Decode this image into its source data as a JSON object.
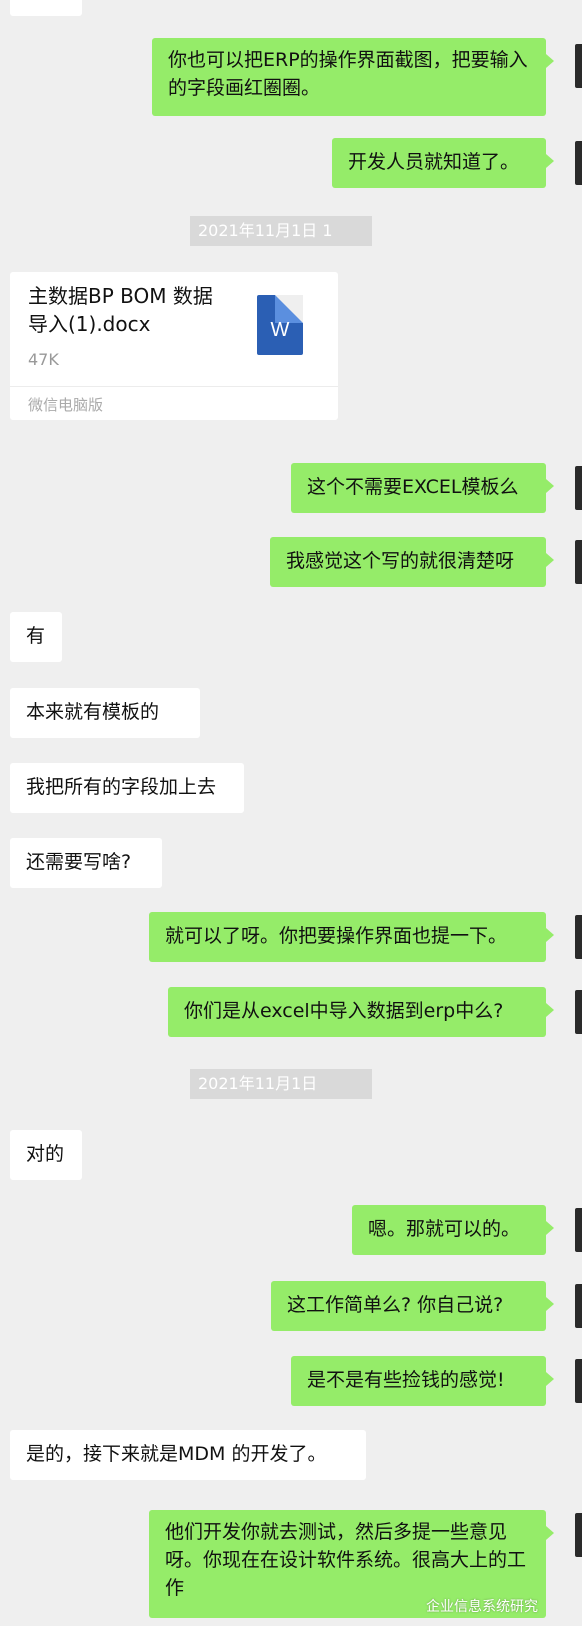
{
  "messages": [
    {
      "side": "right",
      "text": "你也可以把ERP的操作界面截图，把要输入的字段画红圈圈。"
    },
    {
      "side": "right",
      "text": "开发人员就知道了。"
    },
    {
      "side": "system",
      "text": "2021年11月1日 1"
    },
    {
      "side": "left-file",
      "file_name": "主数据BP BOM 数据导入(1).docx",
      "file_size": "47K",
      "source": "微信电脑版",
      "icon_letter": "W"
    },
    {
      "side": "right",
      "text": "这个不需要EXCEL模板么"
    },
    {
      "side": "right",
      "text": "我感觉这个写的就很清楚呀"
    },
    {
      "side": "left",
      "text": "有"
    },
    {
      "side": "left",
      "text": "本来就有模板的"
    },
    {
      "side": "left",
      "text": "我把所有的字段加上去"
    },
    {
      "side": "left",
      "text": "还需要写啥?"
    },
    {
      "side": "right",
      "text": "就可以了呀。你把要操作界面也提一下。"
    },
    {
      "side": "right",
      "text": "你们是从excel中导入数据到erp中么?"
    },
    {
      "side": "system",
      "text": "2021年11月1日"
    },
    {
      "side": "left",
      "text": "对的"
    },
    {
      "side": "right",
      "text": "嗯。那就可以的。"
    },
    {
      "side": "right",
      "text": "这工作简单么? 你自己说?"
    },
    {
      "side": "right",
      "text": "是不是有些捡钱的感觉!"
    },
    {
      "side": "left",
      "text": "是的，接下来就是MDM 的开发了。"
    },
    {
      "side": "right",
      "text": "他们开发你就去测试，然后多提一些意见呀。你现在在设计软件系统。很高大上的工作"
    }
  ],
  "watermark": "企业信息系统研究",
  "colors": {
    "background": "#efefef",
    "right_bubble": "#95ec69",
    "left_bubble": "#ffffff"
  }
}
